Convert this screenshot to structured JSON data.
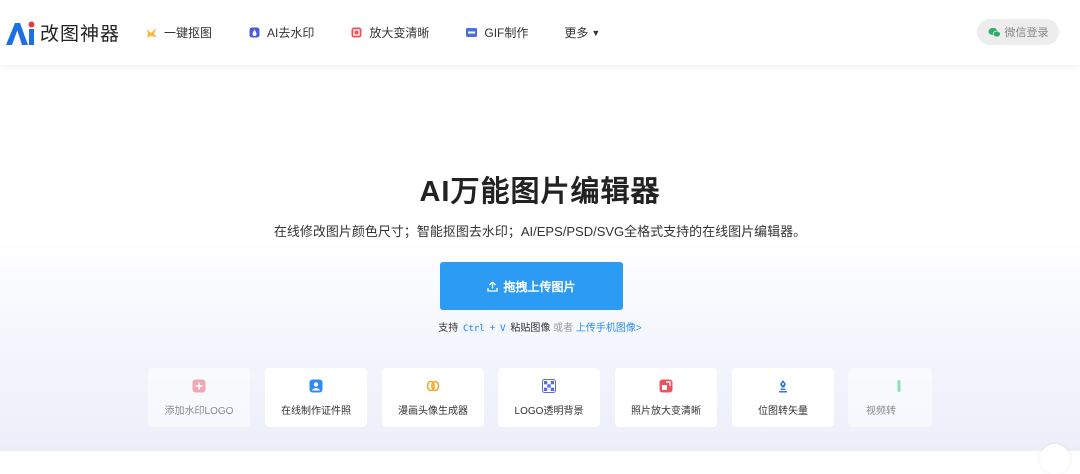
{
  "brand": {
    "name": "改图神器"
  },
  "nav": {
    "items": [
      {
        "label": "一键抠图",
        "icon": "cutout-icon"
      },
      {
        "label": "AI去水印",
        "icon": "watermark-icon"
      },
      {
        "label": "放大变清晰",
        "icon": "enlarge-icon"
      },
      {
        "label": "GIF制作",
        "icon": "gif-icon"
      }
    ],
    "more": "更多"
  },
  "login": {
    "label": "微信登录",
    "icon": "wechat-icon"
  },
  "hero": {
    "title": "AI万能图片编辑器",
    "subtitle": "在线修改图片颜色尺寸；智能抠图去水印；AI/EPS/PSD/SVG全格式支持的在线图片编辑器。",
    "upload_label": "拖拽上传图片",
    "hint_prefix": "支持",
    "key_ctrl": "Ctrl",
    "key_plus": "+",
    "key_v": "V",
    "hint_middle": "粘贴图像",
    "hint_or": "或者",
    "hint_link": "上传手机图像>"
  },
  "tools": [
    {
      "label": "添加水印LOGO",
      "icon": "add-watermark-icon",
      "color": "#f26b7a"
    },
    {
      "label": "在线制作证件照",
      "icon": "id-photo-icon",
      "color": "#2f8cf0"
    },
    {
      "label": "漫画头像生成器",
      "icon": "cartoon-avatar-icon",
      "color": "#f5a623"
    },
    {
      "label": "LOGO透明背景",
      "icon": "transparent-bg-icon",
      "color": "#5b6ce0"
    },
    {
      "label": "照片放大变清晰",
      "icon": "photo-enlarge-icon",
      "color": "#f0505a"
    },
    {
      "label": "位图转矢量",
      "icon": "vectorize-icon",
      "color": "#2a7fe0"
    },
    {
      "label": "视频转",
      "icon": "video-convert-icon",
      "color": "#3ecf6a"
    }
  ],
  "colors": {
    "accent": "#2b9bf4",
    "link": "#2b8ef0"
  }
}
